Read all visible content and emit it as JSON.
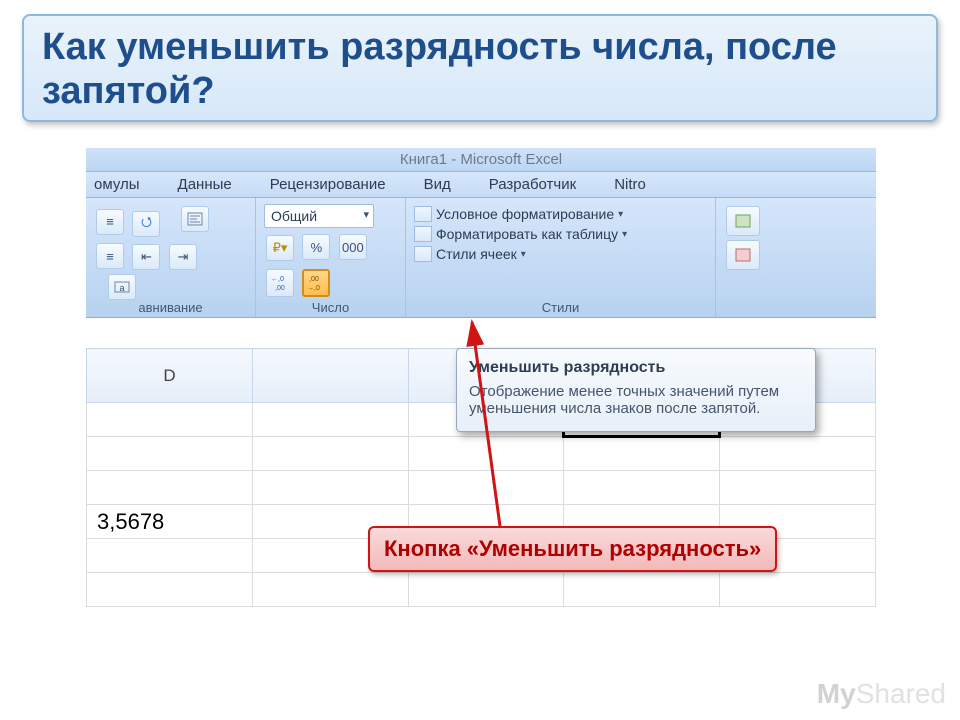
{
  "question": "Как уменьшить разрядность числа, после запятой?",
  "titlebar": "Книга1 - Microsoft Excel",
  "tabs": [
    "омулы",
    "Данные",
    "Рецензирование",
    "Вид",
    "Разработчик",
    "Nitro"
  ],
  "ribbon": {
    "alignment_label": "авнивание",
    "number_label": "Число",
    "styles_label": "Стили",
    "format_combo": "Общий",
    "percent": "%",
    "thousands": "000",
    "increase_decimal_glyph": "←,0\n ,00",
    "decrease_decimal_glyph": ",00\n→,0",
    "cond_format": "Условное форматирование",
    "as_table": "Форматировать как таблицу",
    "cell_styles": "Стили ячеек"
  },
  "tooltip": {
    "title": "Уменьшить разрядность",
    "body": "Отображение менее точных значений путем уменьшения числа знаков после запятой."
  },
  "sheet": {
    "col_header": "D",
    "cell_value": "3,5678"
  },
  "callout": "Кнопка «Уменьшить разрядность»",
  "watermark_left": "MyShared",
  "watermark_prefix": "My"
}
